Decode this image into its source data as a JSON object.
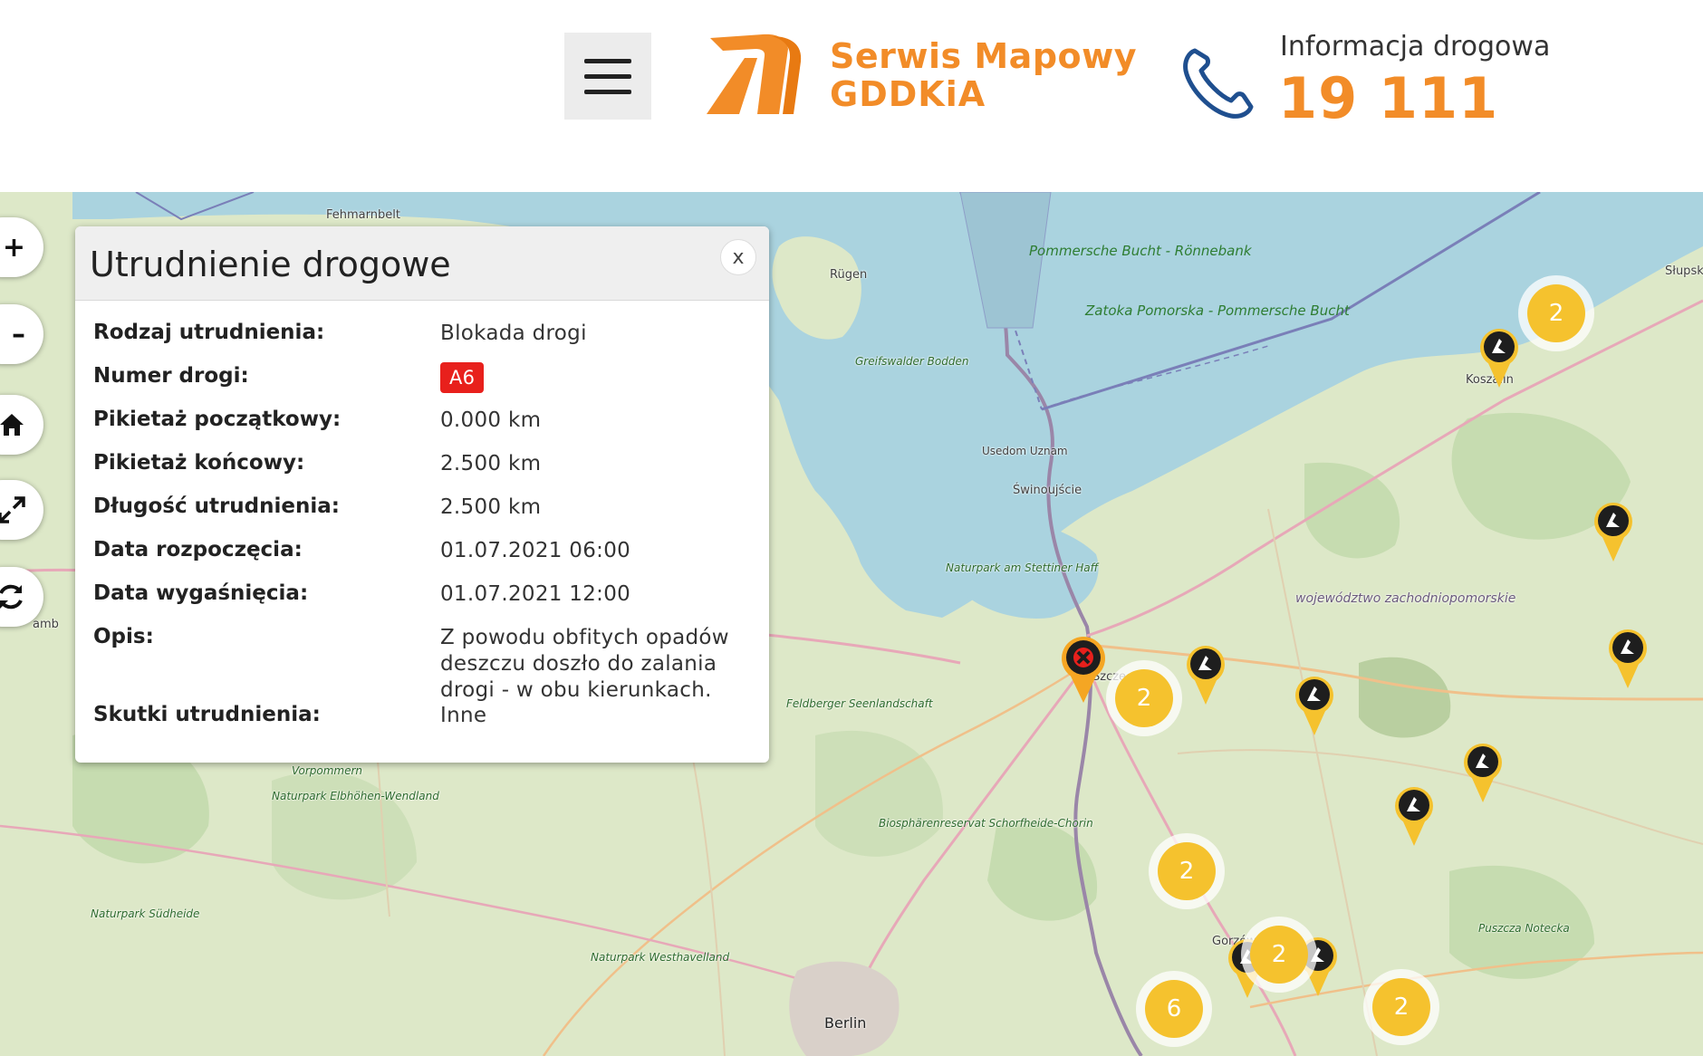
{
  "header": {
    "brand_line1": "Serwis Mapowy",
    "brand_line2": "GDDKiA",
    "info_label": "Informacja drogowa",
    "info_number": "19 111",
    "accent_color": "#f28c28",
    "phone_color": "#1f4f8f"
  },
  "map_controls": [
    {
      "name": "zoom-in",
      "label": "+"
    },
    {
      "name": "zoom-out",
      "label": "–"
    },
    {
      "name": "home",
      "icon": "home-icon"
    },
    {
      "name": "fullscreen",
      "icon": "expand-icon"
    },
    {
      "name": "refresh",
      "icon": "refresh-icon"
    }
  ],
  "map_labels": {
    "rugen": "Rügen",
    "pommersche_bucht": "Pommersche Bucht - Rönnebank",
    "zatoka": "Zatoka Pomorska - Pommersche Bucht",
    "greifswalder": "Greifswalder Bodden",
    "usedom": "Usedom Uznam",
    "swinoujscie": "Świnoujście",
    "naturpark_stettiner": "Naturpark am Stettiner Haff",
    "wojewodztwo": "województwo zachodniopomorskie",
    "koszalin": "Koszalin",
    "slupsk": "Słupsk",
    "szczecin": "Szczecin",
    "feldberger": "Feldberger Seenlandschaft",
    "vorpommern": "Vorpommern",
    "naturpark_elbhohen": "Naturpark Elbhöhen-Wendland",
    "biosphaerenreservat": "Biosphärenreservat Schorfheide-Chorin",
    "naturpark_sudheide": "Naturpark Südheide",
    "naturpark_westhavelland": "Naturpark Westhavelland",
    "berlin": "Berlin",
    "puszcza_notecka": "Puszcza Notecka",
    "gorzow": "Gorzów",
    "fehmarnbelt": "Fehmarnbelt",
    "hamburg": "amb"
  },
  "clusters": [
    {
      "count": "2"
    },
    {
      "count": "2"
    },
    {
      "count": "2"
    },
    {
      "count": "2"
    },
    {
      "count": "6"
    },
    {
      "count": "2"
    }
  ],
  "popup": {
    "title": "Utrudnienie drogowe",
    "close_label": "x",
    "rows": [
      {
        "label": "Rodzaj utrudnienia:",
        "value": "Blokada drogi"
      },
      {
        "label": "Numer drogi:",
        "value": "A6"
      },
      {
        "label": "Pikietaż początkowy:",
        "value": "0.000 km"
      },
      {
        "label": "Pikietaż końcowy:",
        "value": "2.500 km"
      },
      {
        "label": "Długość utrudnienia:",
        "value": "2.500 km"
      },
      {
        "label": "Data rozpoczęcia:",
        "value": "01.07.2021 06:00"
      },
      {
        "label": "Data wygaśnięcia:",
        "value": "01.07.2021 12:00"
      },
      {
        "label": "Opis:",
        "value": "Z powodu obfitych opadów deszczu doszło do zalania drogi - w obu kierunkach."
      },
      {
        "label": "Skutki utrudnienia:",
        "value": "Inne"
      }
    ]
  }
}
